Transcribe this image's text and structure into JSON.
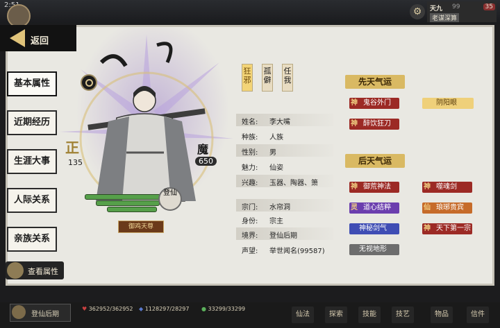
{
  "topbar": {
    "clock": "2:51",
    "player_short": "天九",
    "value": "99",
    "sub": "老谋深算",
    "badge": "35"
  },
  "back_label": "返回",
  "nav": [
    "基本属性",
    "近期经历",
    "生涯大事",
    "人际关系",
    "亲族关系"
  ],
  "view_attr_label": "查看属性",
  "character": {
    "zheng_value": "135",
    "mo_label": "魔",
    "mo_value": "650",
    "seal_text": "登仙",
    "title_plate": "御鸡天尊"
  },
  "tags": [
    "狂邪",
    "孤僻",
    "任我"
  ],
  "info": [
    {
      "k": "姓名:",
      "v": "李大嘴"
    },
    {
      "k": "种族:",
      "v": "人族"
    },
    {
      "k": "性别:",
      "v": "男"
    },
    {
      "k": "魅力:",
      "v": "仙姿"
    },
    {
      "k": "兴趣:",
      "v": "玉器、陶器、箫"
    },
    {
      "k": "宗门:",
      "v": "水帘洞"
    },
    {
      "k": "身份:",
      "v": "宗主"
    },
    {
      "k": "境界:",
      "v": "登仙后期"
    },
    {
      "k": "声望:",
      "v": "举世闻名(99587)"
    }
  ],
  "innate_title": "先天气运",
  "innate": [
    {
      "label": "鬼谷外门",
      "shen": "神"
    },
    {
      "label": "阴阳眼",
      "shen": ""
    },
    {
      "label": "醉饮狂刀",
      "shen": "神"
    }
  ],
  "acquired_title": "后天气运",
  "acquired": [
    {
      "label": "御荒神法",
      "shen": "神"
    },
    {
      "label": "噬魂剑",
      "shen": "神"
    },
    {
      "label": "道心结粹",
      "shen": "灵"
    },
    {
      "label": "琅琊贵宾",
      "shen": "仙"
    },
    {
      "label": "神秘剑气",
      "shen": ""
    },
    {
      "label": "天下第一宗",
      "shen": "神"
    },
    {
      "label": "无视地形",
      "shen": ""
    }
  ],
  "bottom": {
    "realm": "登仙后期",
    "hp": "362952/362952",
    "mp": "1128297/28297",
    "sp": "33299/33299"
  },
  "menu": [
    "仙法",
    "探索",
    "技能",
    "技艺",
    "物品",
    "信件"
  ]
}
